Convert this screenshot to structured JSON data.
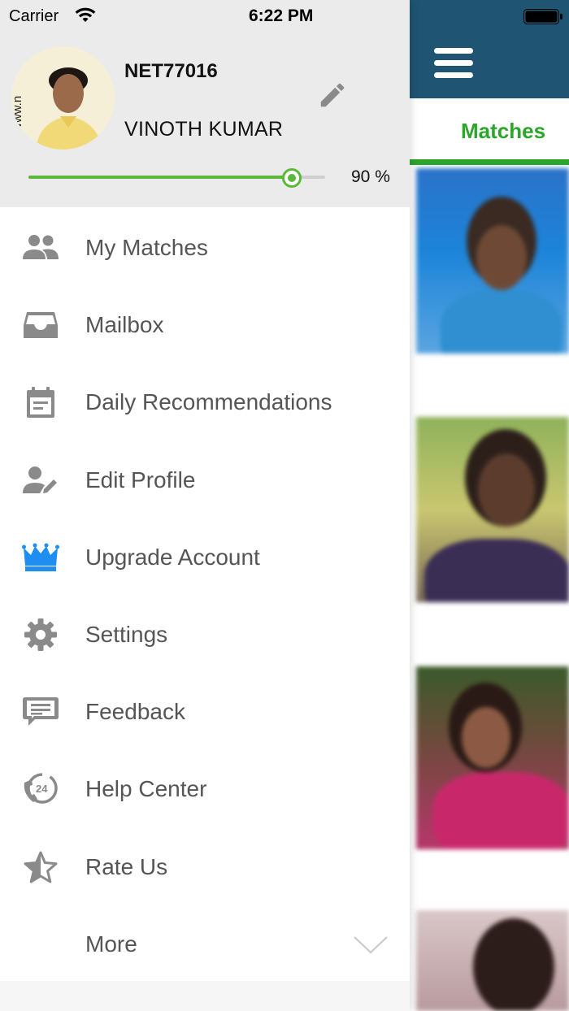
{
  "status_bar": {
    "carrier": "Carrier",
    "time": "6:22 PM"
  },
  "profile": {
    "user_id": "NET77016",
    "name": "VINOTH KUMAR",
    "completion_percent": 90,
    "completion_label": "90 %",
    "avatar_watermark": "www.n"
  },
  "menu": {
    "items": [
      {
        "label": "My Matches",
        "icon": "people-icon"
      },
      {
        "label": "Mailbox",
        "icon": "inbox-icon"
      },
      {
        "label": "Daily Recommendations",
        "icon": "calendar-icon"
      },
      {
        "label": "Edit Profile",
        "icon": "user-edit-icon"
      },
      {
        "label": "Upgrade Account",
        "icon": "crown-icon"
      },
      {
        "label": "Settings",
        "icon": "gear-icon"
      },
      {
        "label": "Feedback",
        "icon": "chat-icon"
      },
      {
        "label": "Help Center",
        "icon": "support-24-icon"
      },
      {
        "label": "Rate Us",
        "icon": "star-icon"
      },
      {
        "label": "More",
        "icon": "chevron-down-icon"
      }
    ]
  },
  "background_screen": {
    "tab_label": "Matches"
  },
  "colors": {
    "header_bg": "#1f5472",
    "accent_green": "#2ca62a",
    "progress_green": "#5ab83a",
    "crown_blue": "#1e8ef0",
    "menu_icon_grey": "#8a8a8a",
    "menu_text": "#555555"
  }
}
